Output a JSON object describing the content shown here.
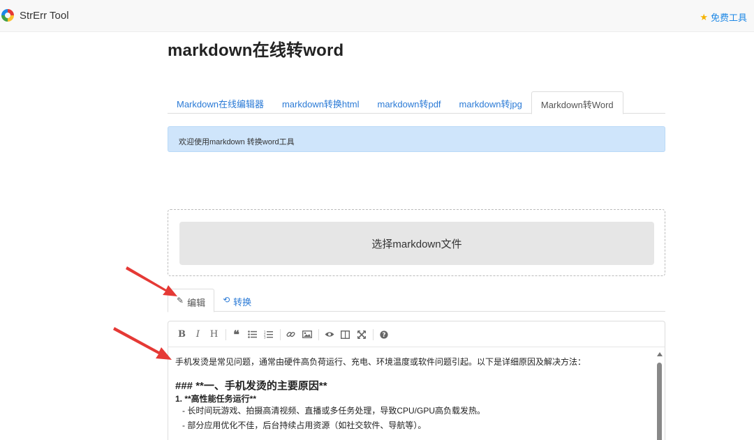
{
  "navbar": {
    "brand": "StrErr Tool",
    "free_tools": "免费工具"
  },
  "page": {
    "title": "markdown在线转word"
  },
  "tabs": [
    {
      "label": "Markdown在线编辑器",
      "active": false
    },
    {
      "label": "markdown转换html",
      "active": false
    },
    {
      "label": "markdown转pdf",
      "active": false
    },
    {
      "label": "markdown转jpg",
      "active": false
    },
    {
      "label": "Markdown转Word",
      "active": true
    }
  ],
  "alert": {
    "text": "欢迎使用markdown 转换word工具"
  },
  "upload": {
    "button_label": "选择markdown文件"
  },
  "mode_tabs": {
    "edit": "编辑",
    "convert": "转换"
  },
  "toolbar": {
    "buttons": [
      "B",
      "I",
      "H",
      "❝",
      "list",
      "ordered-list",
      "link",
      "image",
      "preview",
      "side-by-side",
      "fullscreen",
      "help"
    ]
  },
  "editor": {
    "line1": "手机发烫是常见问题，通常由硬件高负荷运行、充电、环境温度或软件问题引起。以下是详细原因及解决方法：",
    "heading": "### **一、手机发烫的主要原因**",
    "item1": "1. **高性能任务运行**",
    "item1_sub1": "   - 长时间玩游戏、拍摄高清视频、直播或多任务处理，导致CPU/GPU高负载发热。",
    "item1_sub2": "   - 部分应用优化不佳，后台持续占用资源（如社交软件、导航等）。"
  },
  "colors": {
    "link": "#2a7ad6",
    "alert_bg": "#cfe5fb",
    "annotation_arrow": "#e53935"
  }
}
